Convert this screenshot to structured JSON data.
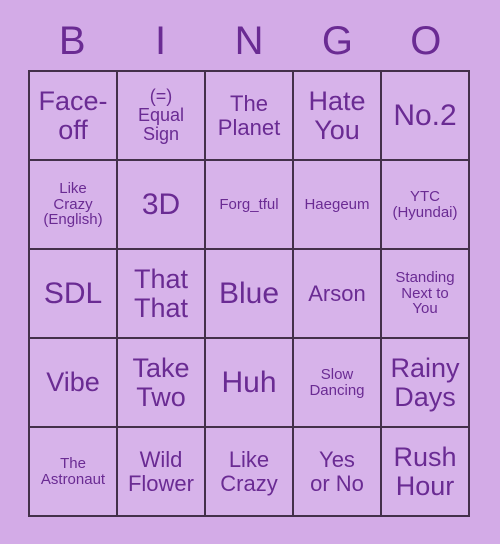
{
  "card": {
    "header_letters": [
      "B",
      "I",
      "N",
      "G",
      "O"
    ],
    "colors": {
      "background": "#d3abe7",
      "cell_fill": "#d7b3ea",
      "text": "#6a2b93",
      "grid_line": "#43304a"
    },
    "rows": [
      [
        {
          "text": "Face-\noff",
          "size": "fs-lg"
        },
        {
          "text": "(=)\nEqual\nSign",
          "size": "fs-sm"
        },
        {
          "text": "The\nPlanet",
          "size": "fs-md"
        },
        {
          "text": "Hate\nYou",
          "size": "fs-lg"
        },
        {
          "text": "No.2",
          "size": "fs-xl"
        }
      ],
      [
        {
          "text": "Like\nCrazy\n(English)",
          "size": "fs-xs"
        },
        {
          "text": "3D",
          "size": "fs-xl"
        },
        {
          "text": "Forg_tful",
          "size": "fs-xs"
        },
        {
          "text": "Haegeum",
          "size": "fs-xs"
        },
        {
          "text": "YTC\n(Hyundai)",
          "size": "fs-xs"
        }
      ],
      [
        {
          "text": "SDL",
          "size": "fs-xl"
        },
        {
          "text": "That\nThat",
          "size": "fs-lg"
        },
        {
          "text": "Blue",
          "size": "fs-xl"
        },
        {
          "text": "Arson",
          "size": "fs-md"
        },
        {
          "text": "Standing\nNext to\nYou",
          "size": "fs-xs"
        }
      ],
      [
        {
          "text": "Vibe",
          "size": "fs-lg"
        },
        {
          "text": "Take\nTwo",
          "size": "fs-lg"
        },
        {
          "text": "Huh",
          "size": "fs-xl"
        },
        {
          "text": "Slow\nDancing",
          "size": "fs-xs"
        },
        {
          "text": "Rainy\nDays",
          "size": "fs-lg"
        }
      ],
      [
        {
          "text": "The\nAstronaut",
          "size": "fs-xs"
        },
        {
          "text": "Wild\nFlower",
          "size": "fs-md"
        },
        {
          "text": "Like\nCrazy",
          "size": "fs-md"
        },
        {
          "text": "Yes\nor No",
          "size": "fs-md"
        },
        {
          "text": "Rush\nHour",
          "size": "fs-lg"
        }
      ]
    ]
  }
}
